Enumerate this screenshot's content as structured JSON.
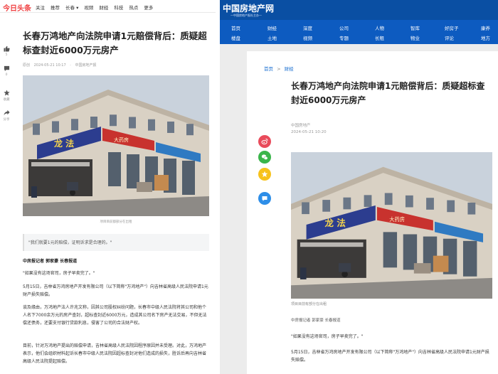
{
  "left": {
    "logo": "今日头条",
    "nav": [
      "关注",
      "推荐",
      "长春 ▾",
      "视频",
      "财经",
      "科技",
      "热点",
      "更多"
    ],
    "rail": {
      "like_count": "5",
      "comment_count": "0",
      "favorite_label": "收藏",
      "share_label": "分享"
    },
    "article": {
      "title": "长春万鸿地产向法院申请1元赔偿背后：质疑超标查封近6000万元房产",
      "meta": [
        "原创",
        "2024-05-21 10:17",
        "·",
        "中国房地产报"
      ],
      "caption": "项目目前都部分在出租",
      "quote": "\"我们就要1元的赔偿，证明诉求是合理的。\"",
      "byline": "中房报记者  郭家豪  长春报道",
      "paragraphs": [
        "\"如果没有这场官司，房子早卖完了。\"",
        "5月15日，吉林省万鸿房地产开发有限公司（以下简称\"万鸿地产\"）向吉林省高级人民法院申请1元财产损失赔偿。",
        "谈及缘由，万鸿地产法人许兆文称，因其公司股权纠纷问题，长春市中级人民法院将其公司和他个人名下7000余万元的房产查封，超标查封近6000万元，造成其公司名下房产无法交易，不但无法偿还债务，还要支付银行贷款利息，侵害了公司的合法财产权。",
        "目前，针对万鸿地产提出的赔偿申请，吉林省高级人民法院因程序原因并未受理。对此，万鸿地产表示，他们会组织材料起诉长春市中级人民法院因超标查封对他们造成的损失，胜诉后再向吉林省高级人民法院提起赔偿。"
      ]
    }
  },
  "right": {
    "logo": "中国房地产网",
    "slogan": "—中国房地产报社主办—",
    "nav_row1": [
      "首页",
      "财经",
      "深度",
      "公司",
      "人物",
      "智库",
      "好房子",
      "康养"
    ],
    "nav_row2": [
      "楼盘",
      "土地",
      "视频",
      "专题",
      "长租",
      "物业",
      "评论",
      "地方"
    ],
    "breadcrumb": [
      "首页",
      ">",
      "财经"
    ],
    "article": {
      "title": "长春万鸿地产向法院申请1元赔偿背后：质疑超标查封近6000万元房产",
      "source": "中国房地产",
      "time": "2024-05-21 10:20",
      "caption": "项目目前有部分在出租",
      "byline": "中房报记者 郭家豪 长春报道",
      "quote": "\"如果没有这场官司，房子早卖完了。\"",
      "p1": "5月15日，吉林省万鸿房地产开发有限公司（以下简称\"万鸿地产\"）向吉林省高级人民法院申请1元财产损失赔偿。"
    }
  },
  "photo": {
    "sign_left": "龙 法",
    "sign_right": "大药房"
  },
  "colors": {
    "toutiao_red": "#f04142",
    "fdc_blue": "#0a4fa3",
    "fdc_nav": "#0d5bc0",
    "share_weibo": "#e94b5b",
    "share_wechat": "#3ab54a",
    "share_qzone": "#f7c21b",
    "share_qq": "#2d8ee8"
  },
  "icons": [
    "thumb-up-icon",
    "comment-icon",
    "star-icon",
    "share-icon",
    "weibo-icon",
    "wechat-icon",
    "qzone-icon",
    "qq-icon"
  ]
}
